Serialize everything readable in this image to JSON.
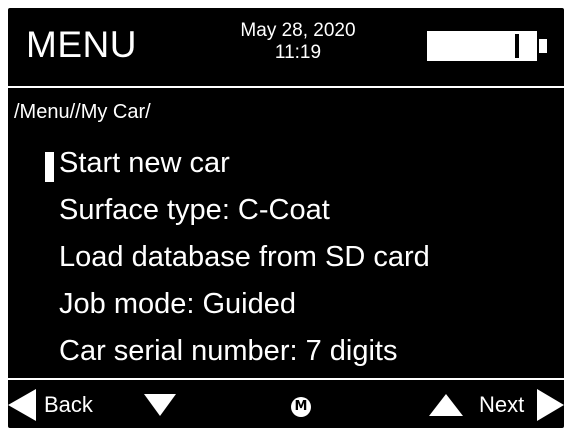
{
  "header": {
    "title": "MENU",
    "date": "May 28, 2020",
    "time": "11:19",
    "battery_icon": "battery-icon"
  },
  "breadcrumb": "/Menu//My Car/",
  "menu": {
    "items": [
      {
        "label": "Start new car",
        "selected": true
      },
      {
        "label": "Surface type: C-Coat"
      },
      {
        "label": "Load database from SD card"
      },
      {
        "label": "Job mode: Guided"
      },
      {
        "label": "Car serial number: 7 digits"
      }
    ]
  },
  "footer": {
    "back_label": "Back",
    "next_label": "Next",
    "menu_glyph": "M",
    "icons": [
      "left-arrow-icon",
      "down-arrow-icon",
      "menu-m-icon",
      "up-arrow-icon",
      "right-arrow-icon"
    ]
  },
  "colors": {
    "background": "#000000",
    "foreground": "#ffffff"
  }
}
